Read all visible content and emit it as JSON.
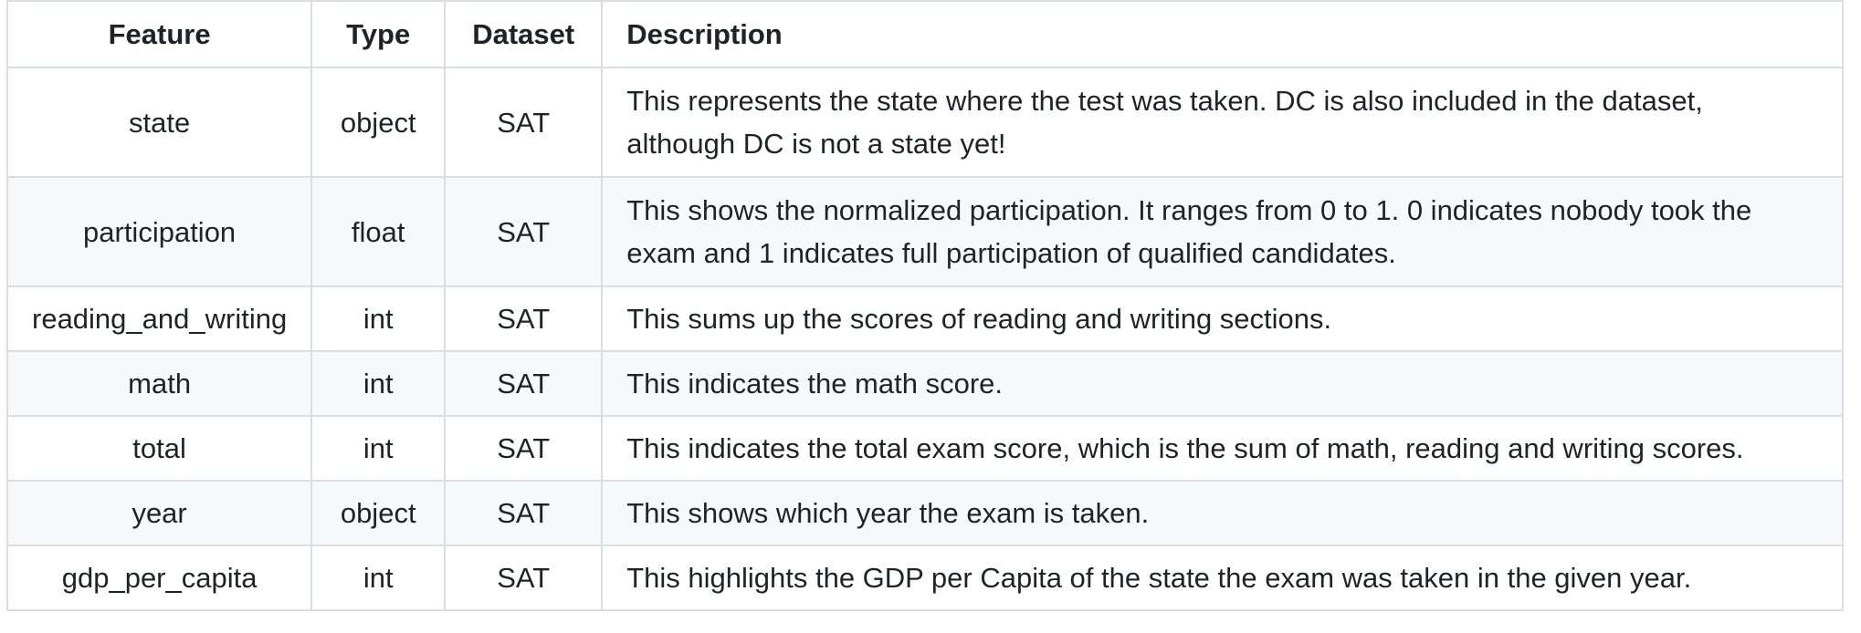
{
  "table": {
    "headers": {
      "feature": "Feature",
      "type": "Type",
      "dataset": "Dataset",
      "description": "Description"
    },
    "rows": [
      {
        "feature": "state",
        "type": "object",
        "dataset": "SAT",
        "description": "This represents the state where the test was taken. DC is also included in the dataset, although DC is not a state yet!"
      },
      {
        "feature": "participation",
        "type": "float",
        "dataset": "SAT",
        "description": "This shows the normalized participation. It ranges from 0 to 1. 0 indicates nobody took the exam and 1 indicates full participation of qualified candidates."
      },
      {
        "feature": "reading_and_writing",
        "type": "int",
        "dataset": "SAT",
        "description": "This sums up the scores of reading and writing sections."
      },
      {
        "feature": "math",
        "type": "int",
        "dataset": "SAT",
        "description": "This indicates the math score."
      },
      {
        "feature": "total",
        "type": "int",
        "dataset": "SAT",
        "description": "This indicates the total exam score, which is the sum of math, reading and writing scores."
      },
      {
        "feature": "year",
        "type": "object",
        "dataset": "SAT",
        "description": "This shows which year the exam is taken."
      },
      {
        "feature": "gdp_per_capita",
        "type": "int",
        "dataset": "SAT",
        "description": "This highlights the GDP per Capita of the state the exam was taken in the given year."
      }
    ]
  }
}
